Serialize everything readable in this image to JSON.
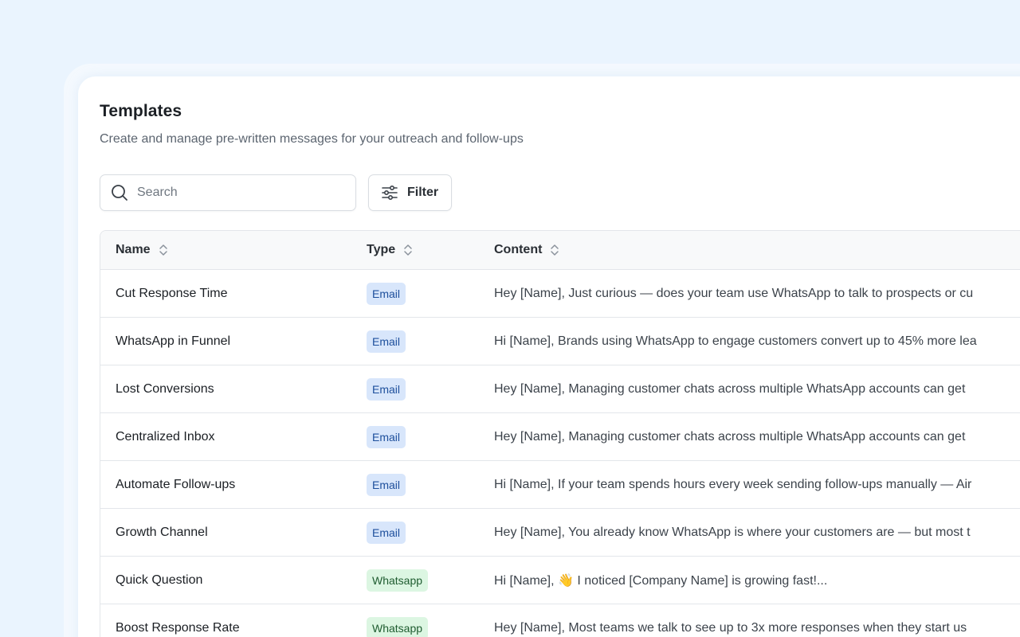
{
  "page": {
    "title": "Templates",
    "subtitle": "Create and manage pre-written messages for your outreach and follow-ups"
  },
  "toolbar": {
    "search_placeholder": "Search",
    "filter_label": "Filter"
  },
  "table": {
    "columns": [
      "Name",
      "Type",
      "Content"
    ],
    "rows": [
      {
        "name": "Cut Response Time",
        "type": "Email",
        "content": "Hey [Name], Just curious — does your team use WhatsApp to talk to prospects or cu"
      },
      {
        "name": "WhatsApp in Funnel",
        "type": "Email",
        "content": "Hi [Name], Brands using WhatsApp to engage customers convert up to 45% more lea"
      },
      {
        "name": "Lost Conversions",
        "type": "Email",
        "content": "Hey [Name], Managing customer chats across multiple WhatsApp accounts can get"
      },
      {
        "name": "Centralized Inbox",
        "type": "Email",
        "content": "Hey [Name], Managing customer chats across multiple WhatsApp accounts can get"
      },
      {
        "name": "Automate Follow-ups",
        "type": "Email",
        "content": "Hi [Name], If your team spends hours every week sending follow-ups manually — Air"
      },
      {
        "name": "Growth Channel",
        "type": "Email",
        "content": "Hey [Name], You already know WhatsApp is where your customers are — but most t"
      },
      {
        "name": "Quick Question",
        "type": "Whatsapp",
        "content": "Hi [Name], 👋 I noticed [Company Name] is growing fast!..."
      },
      {
        "name": "Boost Response Rate",
        "type": "Whatsapp",
        "content": "Hey [Name], Most teams we talk to see up to 3x more responses when they start us"
      }
    ]
  },
  "colors": {
    "email_badge_bg": "#d8e6fb",
    "whatsapp_badge_bg": "#dcf6e2"
  }
}
